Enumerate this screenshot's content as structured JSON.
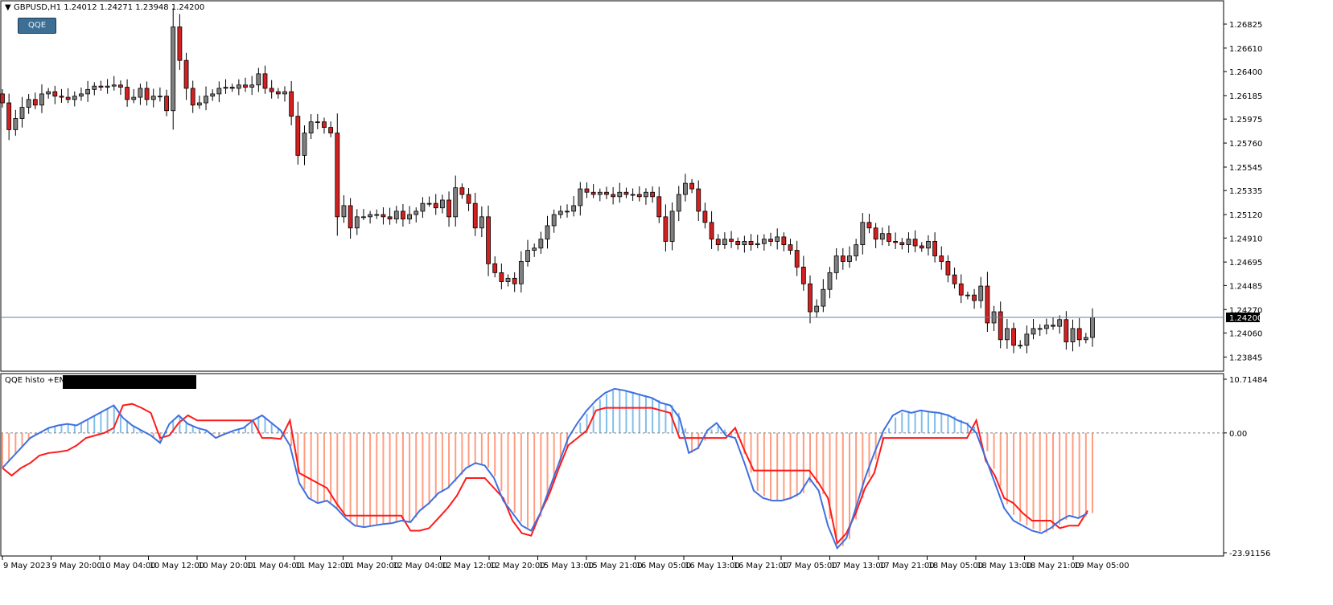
{
  "header": {
    "symbol_info": "GBPUSD,H1  1.24012 1.24271 1.23948 1.24200",
    "button_label": "QQE"
  },
  "indicator": {
    "title": "QQE histo +EMA",
    "redacted": true
  },
  "colors": {
    "bull_candle": "#808080",
    "bear_candle": "#d42020",
    "candle_outline": "#000000",
    "price_line": "#5a7fa8",
    "price_tag_bg": "#000000",
    "qqe_blue": "#3f6fe0",
    "qqe_red": "#ff1a1a",
    "histo_pos": "#7fbfea",
    "histo_neg": "#ff9d80",
    "zero_line": "#808080",
    "button_bg": "#3d6e93"
  },
  "chart_data": [
    {
      "type": "candlestick",
      "symbol": "GBPUSD",
      "timeframe": "H1",
      "ohlc_current": {
        "open": 1.24012,
        "high": 1.24271,
        "low": 1.23948,
        "close": 1.242
      },
      "current_price_label": "1.24200",
      "ylim": [
        1.2379,
        1.2694
      ],
      "y_ticks": [
        "1.26825",
        "1.26610",
        "1.26400",
        "1.26185",
        "1.25975",
        "1.25760",
        "1.25545",
        "1.25335",
        "1.25120",
        "1.24910",
        "1.24695",
        "1.24485",
        "1.24270",
        "1.24060",
        "1.23845"
      ],
      "x_tick_labels": [
        "9 May 2023",
        "9 May 20:00",
        "10 May 04:00",
        "10 May 12:00",
        "10 May 20:00",
        "11 May 04:00",
        "11 May 12:00",
        "11 May 20:00",
        "12 May 04:00",
        "12 May 12:00",
        "12 May 20:00",
        "15 May 13:00",
        "15 May 21:00",
        "16 May 05:00",
        "16 May 13:00",
        "16 May 21:00",
        "17 May 05:00",
        "17 May 13:00",
        "17 May 21:00",
        "18 May 05:00",
        "18 May 13:00",
        "18 May 21:00",
        "19 May 05:00"
      ],
      "close_path": [
        1.2612,
        1.2588,
        1.2598,
        1.2608,
        1.2615,
        1.261,
        1.262,
        1.2622,
        1.2618,
        1.2617,
        1.2615,
        1.2618,
        1.262,
        1.2624,
        1.2627,
        1.2626,
        1.2627,
        1.2628,
        1.2626,
        1.2615,
        1.2617,
        1.2625,
        1.2615,
        1.2618,
        1.2618,
        1.2605,
        1.268,
        1.265,
        1.2625,
        1.261,
        1.2612,
        1.2618,
        1.262,
        1.2625,
        1.2626,
        1.2625,
        1.2628,
        1.2626,
        1.2628,
        1.2638,
        1.2625,
        1.2622,
        1.262,
        1.2622,
        1.26,
        1.2565,
        1.2585,
        1.2595,
        1.2595,
        1.259,
        1.2585,
        1.251,
        1.252,
        1.25,
        1.251,
        1.251,
        1.2512,
        1.2512,
        1.251,
        1.2508,
        1.2515,
        1.2508,
        1.2512,
        1.2515,
        1.2522,
        1.2522,
        1.2518,
        1.2525,
        1.251,
        1.2536,
        1.253,
        1.2522,
        1.25,
        1.251,
        1.2468,
        1.246,
        1.2452,
        1.2455,
        1.245,
        1.247,
        1.248,
        1.2482,
        1.249,
        1.2502,
        1.2512,
        1.2515,
        1.2515,
        1.252,
        1.2535,
        1.2532,
        1.253,
        1.2532,
        1.253,
        1.2528,
        1.2532,
        1.253,
        1.253,
        1.2528,
        1.2532,
        1.2528,
        1.251,
        1.2488,
        1.2515,
        1.253,
        1.254,
        1.2535,
        1.2515,
        1.2505,
        1.249,
        1.2485,
        1.249,
        1.2488,
        1.2485,
        1.2488,
        1.2485,
        1.2486,
        1.249,
        1.2488,
        1.2492,
        1.2485,
        1.248,
        1.2465,
        1.245,
        1.2425,
        1.243,
        1.2445,
        1.246,
        1.2475,
        1.247,
        1.2475,
        1.2485,
        1.2505,
        1.25,
        1.249,
        1.2495,
        1.2488,
        1.2487,
        1.2485,
        1.249,
        1.2484,
        1.2482,
        1.2488,
        1.2475,
        1.247,
        1.2458,
        1.245,
        1.244,
        1.244,
        1.2435,
        1.2448,
        1.2415,
        1.2425,
        1.24,
        1.241,
        1.2395,
        1.2395,
        1.2405,
        1.241,
        1.241,
        1.2413,
        1.2412,
        1.2418,
        1.2398,
        1.241,
        1.24,
        1.2402,
        1.242
      ]
    },
    {
      "type": "line",
      "title": "QQE histo +EMA",
      "ylim": [
        -23.91156,
        10.71484
      ],
      "y_ticks": [
        "10.71484",
        "0.00",
        "-23.91156"
      ],
      "zero_line": 0,
      "series": [
        {
          "values": [
            -7,
            -5,
            -3,
            -1,
            0,
            1,
            1.5,
            1.8,
            1.5,
            2.5,
            3.5,
            4.5,
            5.5,
            3.0,
            1.5,
            0.5,
            -0.5,
            -2.0,
            1.8,
            3.5,
            1.8,
            1.0,
            0.5,
            -1.0,
            -0.2,
            0.5,
            1.0,
            2.5,
            3.5,
            2.0,
            0.5,
            -2.5,
            -10,
            -13,
            -14,
            -13.5,
            -15,
            -17,
            -18.5,
            -18.8,
            -18.5,
            -18.2,
            -18.0,
            -17.5,
            -17.8,
            -15.5,
            -14.0,
            -12.0,
            -11.0,
            -9.0,
            -7.0,
            -6.0,
            -6.5,
            -9.0,
            -13.5,
            -16.0,
            -18.5,
            -19.5,
            -16.0,
            -11.0,
            -6.0,
            -1.0,
            2.0,
            4.5,
            6.5,
            8.0,
            8.8,
            8.5,
            8.0,
            7.5,
            7.0,
            6.0,
            5.5,
            3.0,
            -4.0,
            -3.0,
            0.5,
            2.0,
            -0.5,
            -1.0,
            -6.0,
            -11.5,
            -13.0,
            -13.5,
            -13.5,
            -13.0,
            -12.0,
            -9.0,
            -11.5,
            -18.5,
            -23.0,
            -21.0,
            -15.0,
            -9.0,
            -4.0,
            0.5,
            3.5,
            4.5,
            4.0,
            4.5,
            4.2,
            4.0,
            3.5,
            2.5,
            1.8,
            0,
            -5,
            -10,
            -15,
            -17.5,
            -18.5,
            -19.5,
            -20.0,
            -19.0,
            -17.5,
            -16.5,
            -17.0,
            -16.0
          ]
        },
        {
          "values": [
            -7,
            -8.5,
            -7,
            -6,
            -4.5,
            -4,
            -3.8,
            -3.5,
            -2.5,
            -1.0,
            -0.5,
            0,
            1.0,
            5.5,
            5.8,
            5.0,
            4.0,
            -1.0,
            -0.5,
            2.0,
            3.5,
            2.5,
            2.5,
            2.5,
            2.5,
            2.5,
            2.5,
            2.5,
            -1.0,
            -1.0,
            -1.2,
            2.5,
            -8.0,
            -9.0,
            -10.0,
            -11.0,
            -14.0,
            -16.5,
            -16.5,
            -16.5,
            -16.5,
            -16.5,
            -16.5,
            -16.5,
            -19.5,
            -19.5,
            -19.0,
            -17.0,
            -15.0,
            -12.5,
            -9.0,
            -9.0,
            -9.0,
            -11.0,
            -13.0,
            -17.5,
            -20.0,
            -20.5,
            -16.0,
            -12.0,
            -7.0,
            -2.5,
            -1.0,
            0.5,
            4.5,
            5.0,
            5.0,
            5.0,
            5.0,
            5.0,
            5.0,
            4.5,
            4.0,
            -1.0,
            -1.0,
            -1.0,
            -1.0,
            -1.0,
            -1.0,
            1.0,
            -3.5,
            -7.5,
            -7.5,
            -7.5,
            -7.5,
            -7.5,
            -7.5,
            -7.5,
            -10.0,
            -13.0,
            -22.0,
            -20.0,
            -16.0,
            -11.0,
            -8.0,
            -1.0,
            -1.0,
            -1.0,
            -1.0,
            -1.0,
            -1.0,
            -1.0,
            -1.0,
            -1.0,
            -1.0,
            2.5,
            -5.5,
            -8.5,
            -13.0,
            -14.0,
            -16.0,
            -17.5,
            -17.5,
            -17.5,
            -19.0,
            -18.5,
            -18.5,
            -15.5
          ]
        }
      ]
    }
  ]
}
